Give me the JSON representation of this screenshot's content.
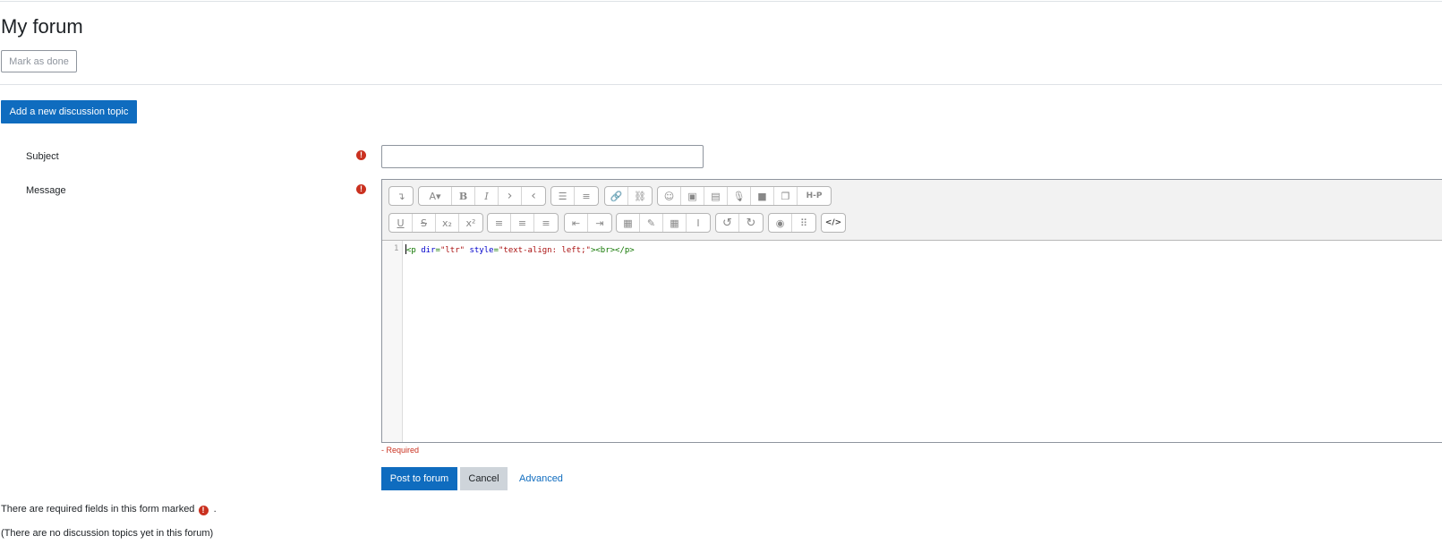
{
  "page": {
    "title": "My forum"
  },
  "mark_done_label": "Mark as done",
  "add_topic_label": "Add a new discussion topic",
  "form": {
    "subject_label": "Subject",
    "message_label": "Message",
    "subject_value": "",
    "required_note": "- Required",
    "post_label": "Post to forum",
    "cancel_label": "Cancel",
    "advanced_label": "Advanced",
    "required_fields_text": "There are required fields in this form marked",
    "required_fields_suffix": "."
  },
  "editor": {
    "line_number": "1",
    "code": {
      "open": "<p ",
      "attr1": "dir",
      "eq1": "=",
      "val1": "\"ltr\"",
      "attr2": "style",
      "eq2": "=",
      "val2": "\"text-align: left;\"",
      "close": "><br></p>"
    },
    "toolbar_row1": [
      [
        "collapse-icon"
      ],
      [
        "font-style-icon",
        "bold-icon",
        "italic-icon",
        "superscript-chevron-icon",
        "subscript-chevron-icon"
      ],
      [
        "unordered-list-icon",
        "ordered-list-icon"
      ],
      [
        "link-icon",
        "unlink-icon"
      ],
      [
        "emoji-icon",
        "image-icon",
        "media-icon",
        "record-audio-icon",
        "record-video-icon",
        "manage-files-icon",
        "h5p-icon"
      ]
    ],
    "toolbar_row2": [
      [
        "underline-icon",
        "strikethrough-icon",
        "subscript-icon",
        "superscript-icon"
      ],
      [
        "align-left-icon",
        "align-center-icon",
        "align-right-icon"
      ],
      [
        "outdent-icon",
        "indent-icon"
      ],
      [
        "equation-icon",
        "special-char-icon",
        "table-icon",
        "clear-format-icon"
      ],
      [
        "undo-icon",
        "redo-icon"
      ],
      [
        "accessibility-checker-icon",
        "screenreader-helper-icon"
      ],
      [
        "html-source-icon"
      ]
    ],
    "glyphs": {
      "collapse": "↴",
      "font": "A▾",
      "bold": "B",
      "italic": "I",
      "sup_chev": "›",
      "sub_chev": "‹",
      "ul": "☰",
      "ol": "≡",
      "link": "🔗",
      "unlink": "⛓",
      "emoji": "☺",
      "image": "▣",
      "media": "▤",
      "audio": "🎙",
      "video": "■",
      "files": "❐",
      "h5p": "H-P",
      "underline": "U",
      "strike": "S",
      "sub": "x₂",
      "sup": "x²",
      "al": "≡",
      "ac": "≡",
      "ar": "≡",
      "outdent": "⇤",
      "indent": "⇥",
      "eq": "▦",
      "char": "✎",
      "table": "▦",
      "clear": "Ⅰ",
      "undo": "↺",
      "redo": "↻",
      "access": "◉",
      "screen": "⠿",
      "html": "</>"
    }
  },
  "empty_state": "(There are no discussion topics yet in this forum)",
  "colors": {
    "accent": "#0f6cbf",
    "required": "#ca3120"
  }
}
